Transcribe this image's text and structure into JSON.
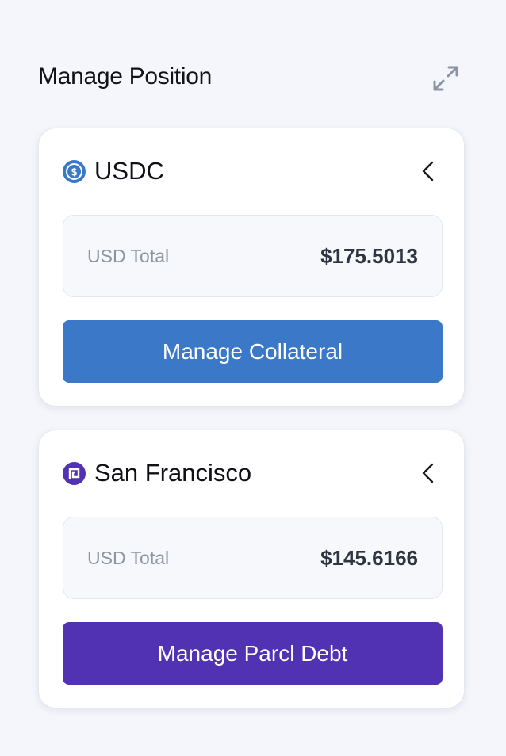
{
  "header": {
    "title": "Manage Position",
    "expand_icon": "expand-arrows-icon"
  },
  "cards": [
    {
      "token": "USDC",
      "icon": "usdc-coin-icon",
      "icon_color": "#3b78c8",
      "label": "USD Total",
      "amount": "$175.5013",
      "button": "Manage Collateral",
      "button_color": "#3b78c8"
    },
    {
      "token": "San Francisco",
      "icon": "parcl-market-icon",
      "icon_color": "#5032b2",
      "label": "USD Total",
      "amount": "$145.6166",
      "button": "Manage Parcl Debt",
      "button_color": "#5032b2"
    }
  ]
}
